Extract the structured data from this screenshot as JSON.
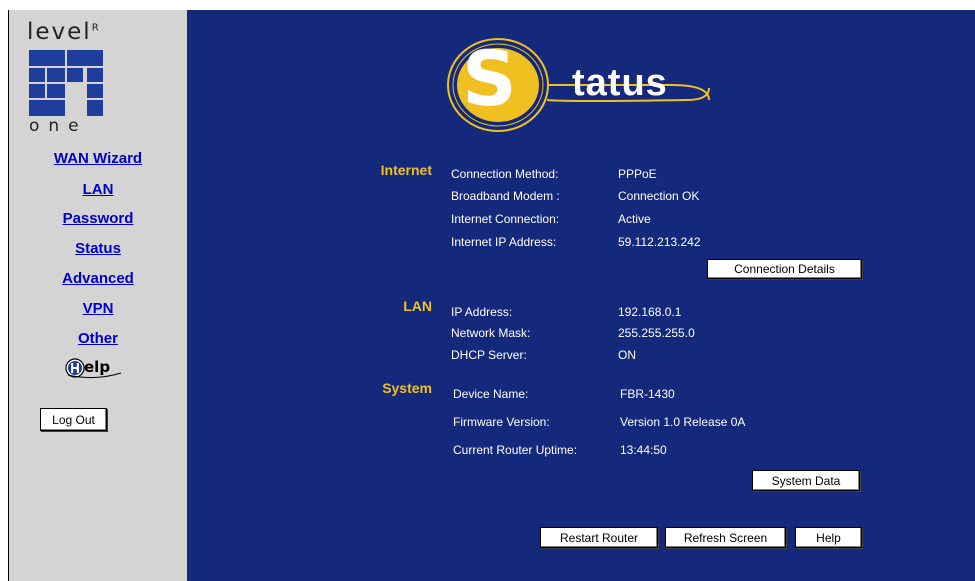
{
  "logo": {
    "top": "level",
    "mark": "R",
    "bottom": "one"
  },
  "nav": {
    "wan_wizard": "WAN Wizard",
    "lan": "LAN",
    "password": "Password",
    "status": "Status",
    "advanced": "Advanced",
    "vpn": "VPN",
    "other": "Other"
  },
  "help_logo": {
    "text": "elp"
  },
  "logout_label": "Log Out",
  "title": {
    "big_letter": "S",
    "rest": "tatus"
  },
  "internet": {
    "section": "Internet",
    "rows": [
      {
        "label": "Connection Method:",
        "value": "PPPoE"
      },
      {
        "label": "Broadband Modem :",
        "value": "Connection OK"
      },
      {
        "label": "Internet Connection:",
        "value": "Active"
      },
      {
        "label": "Internet IP Address:",
        "value": "59.112.213.242"
      }
    ],
    "details_button": "Connection Details"
  },
  "lan": {
    "section": "LAN",
    "rows": [
      {
        "label": "IP Address:",
        "value": "192.168.0.1"
      },
      {
        "label": "Network Mask:",
        "value": "255.255.255.0"
      },
      {
        "label": "DHCP Server:",
        "value": "ON"
      }
    ]
  },
  "system": {
    "section": "System",
    "rows": [
      {
        "label": "Device Name:",
        "value": "FBR-1430"
      },
      {
        "label": "Firmware Version:",
        "value": "Version 1.0 Release 0A"
      },
      {
        "label": "Current Router Uptime:",
        "value": "13:44:50"
      }
    ],
    "data_button": "System Data"
  },
  "bottom_buttons": {
    "restart": "Restart Router",
    "refresh": "Refresh Screen",
    "help": "Help"
  },
  "colors": {
    "main_bg": "#14297c",
    "section_label": "#f0c020",
    "sidebar_bg": "#d4d4d4",
    "nav_link": "#0000cc"
  }
}
